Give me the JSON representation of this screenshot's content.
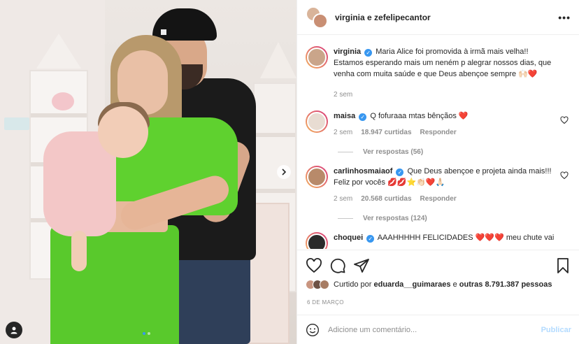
{
  "header": {
    "title": "virginia e zefelipecantor",
    "more_icon": "more-horizontal-icon"
  },
  "caption": {
    "username": "virginia",
    "text": "Maria Alice foi promovida à irmã mais velha!! Estamos esperando mais um neném p alegrar nossos dias, que venha com muita saúde e que Deus abençoe sempre",
    "emoji": "🙌🏻❤️",
    "time": "2 sem"
  },
  "comments": [
    {
      "username": "maisa",
      "text": "Q fofuraaa mtas bênçãos",
      "emoji": "❤️",
      "time": "2 sem",
      "likes": "18.947 curtidas",
      "reply": "Responder",
      "view_replies": "Ver respostas (56)"
    },
    {
      "username": "carlinhosmaiaof",
      "text": "Que Deus abençoe e projeta ainda mais!!! Feliz por vocês",
      "emoji": "💋💋⭐👏🏻❤️🙏🏻",
      "time": "2 sem",
      "likes": "20.568 curtidas",
      "reply": "Responder",
      "view_replies": "Ver respostas (124)"
    },
    {
      "username": "choquei",
      "text": "AAAHHHHH FELICIDADES",
      "emoji": "❤️❤️❤️",
      "text2": "meu chute vai"
    }
  ],
  "likes": {
    "prefix": "Curtido por",
    "user": "eduarda__guimaraes",
    "connector": "e",
    "others": "outras 8.791.387 pessoas"
  },
  "date": "6 DE MARÇO",
  "add_comment": {
    "placeholder": "Adicione um comentário...",
    "publish": "Publicar"
  },
  "colors": {
    "accent": "#3897f0",
    "publish_disabled": "#b3dbff",
    "like_red": "#ed4956",
    "muted": "#8e8e8e"
  }
}
